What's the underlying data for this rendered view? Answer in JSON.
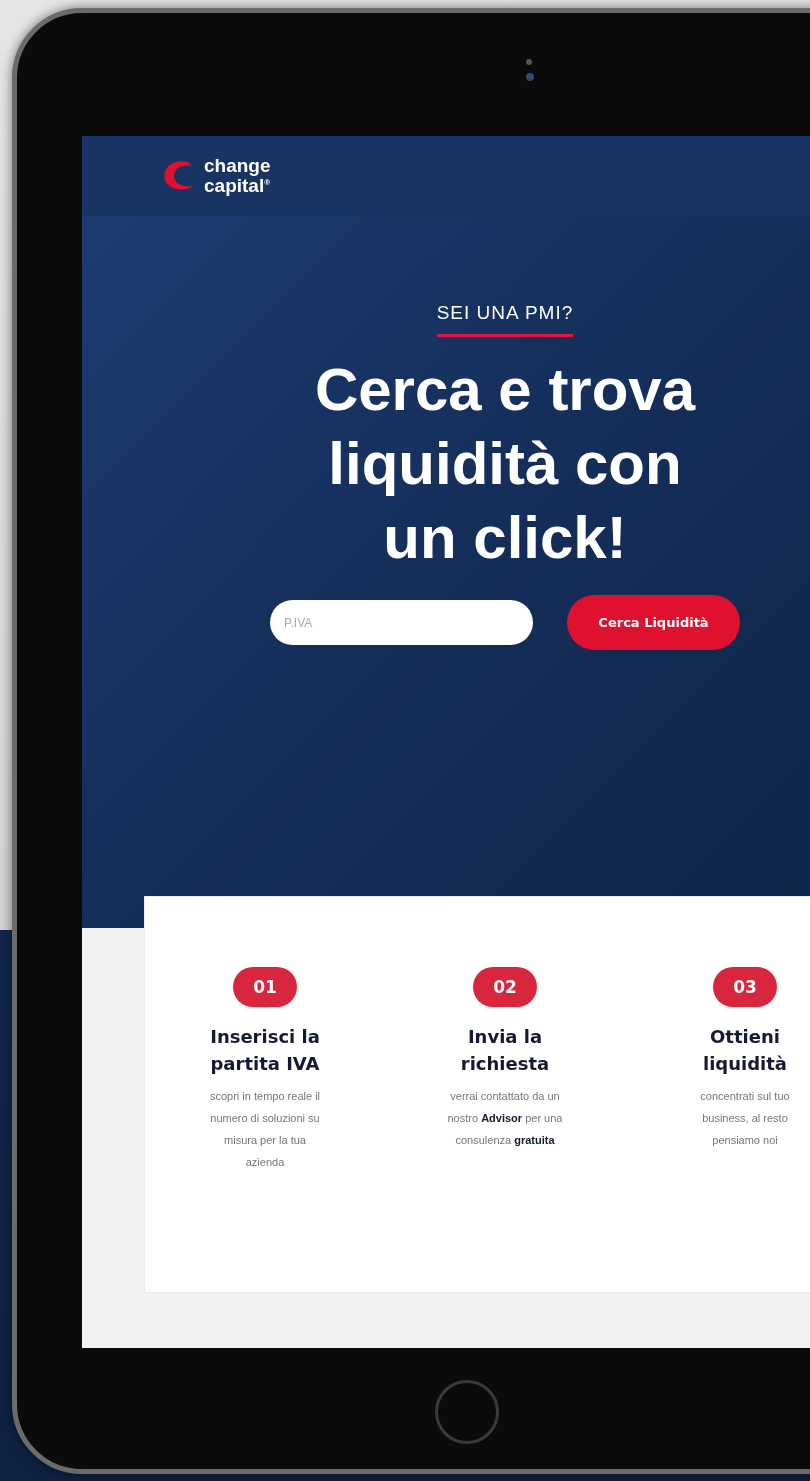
{
  "logo": {
    "line_1": "change",
    "line_2": "capital",
    "mark": "®"
  },
  "hero": {
    "eyebrow": "SEI UNA PMI?",
    "title_lines": [
      "Cerca e trova",
      "liquidità con",
      "un click!"
    ],
    "vat_field": {
      "placeholder": "P.IVA"
    },
    "search_button": "Cerca Liquidità"
  },
  "steps": [
    {
      "number": "01",
      "title_lines": [
        "Inserisci la",
        "partita IVA"
      ],
      "description": "scopri in tempo reale il numero di soluzioni su misura per la tua azienda"
    },
    {
      "number": "02",
      "title_lines": [
        "Invia la",
        "richiesta"
      ],
      "description": "verrai contattato da un nostro **Advisor** per una consulenza **gratuita**"
    },
    {
      "number": "03",
      "title_lines": [
        "Ottieni",
        "liquidità"
      ],
      "description": "concentrati sul tuo business, al resto pensiamo noi"
    }
  ]
}
